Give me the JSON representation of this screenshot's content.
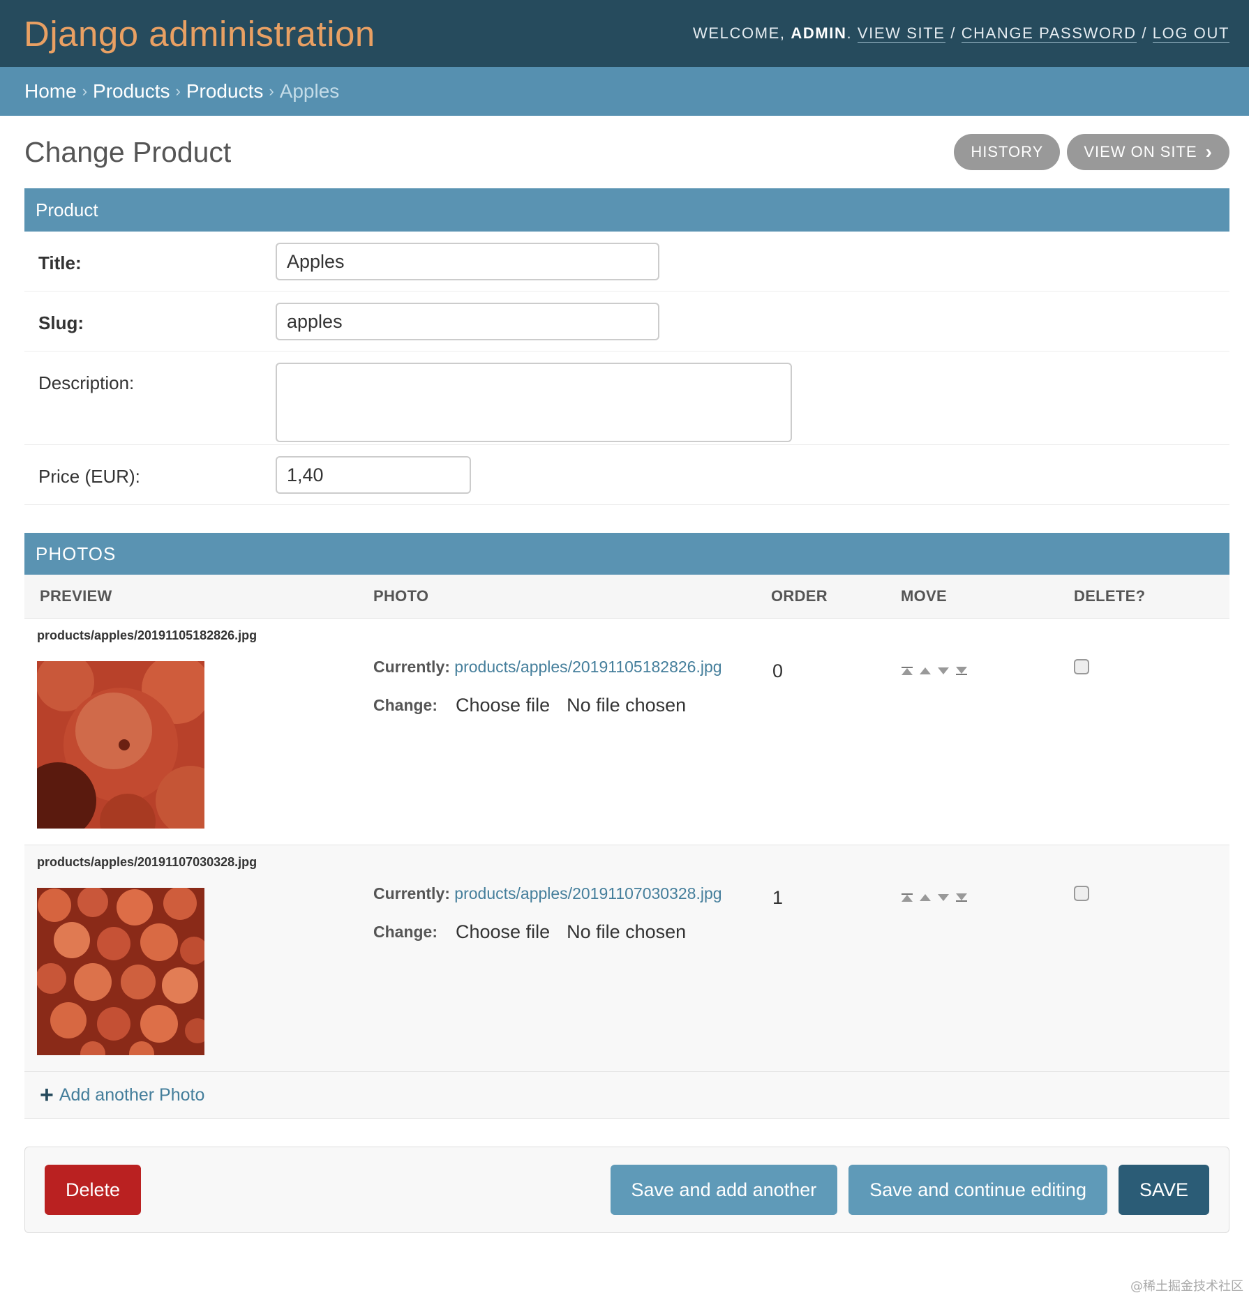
{
  "header": {
    "branding": "Django administration",
    "welcome_prefix": "WELCOME, ",
    "username": "ADMIN",
    "welcome_suffix": ". ",
    "view_site": "VIEW SITE",
    "sep1": " / ",
    "change_password": "CHANGE PASSWORD",
    "sep2": " / ",
    "log_out": "LOG OUT"
  },
  "breadcrumbs": {
    "home": "Home",
    "app": "Products",
    "model": "Products",
    "current": "Apples",
    "separator": "›"
  },
  "page": {
    "title": "Change Product",
    "history": "HISTORY",
    "view_on_site": "VIEW ON SITE",
    "view_on_site_chevron": "›"
  },
  "product_fieldset": {
    "title": "Product",
    "fields": {
      "title_label": "Title:",
      "title_value": "Apples",
      "slug_label": "Slug:",
      "slug_value": "apples",
      "description_label": "Description:",
      "description_value": "",
      "price_label": "Price (EUR):",
      "price_value": "1,40"
    }
  },
  "photos_inline": {
    "title": "PHOTOS",
    "columns": {
      "preview": "PREVIEW",
      "photo": "PHOTO",
      "order": "ORDER",
      "move": "MOVE",
      "delete": "DELETE?"
    },
    "rows": [
      {
        "filename": "products/apples/20191105182826.jpg",
        "currently_label": "Currently:",
        "currently_link": "products/apples/20191105182826.jpg",
        "change_label": "Change:",
        "choose_file": "Choose file",
        "no_file": "No file chosen",
        "order": "0"
      },
      {
        "filename": "products/apples/20191107030328.jpg",
        "currently_label": "Currently:",
        "currently_link": "products/apples/20191107030328.jpg",
        "change_label": "Change:",
        "choose_file": "Choose file",
        "no_file": "No file chosen",
        "order": "1"
      }
    ],
    "add_another": "Add another Photo"
  },
  "submit_row": {
    "delete": "Delete",
    "save_add_another": "Save and add another",
    "save_continue": "Save and continue editing",
    "save": "SAVE"
  },
  "watermark": "@稀土掘金技术社区",
  "colors": {
    "header_bg": "#264b5d",
    "branding": "#e9a063",
    "breadcrumbs_bg": "#5690b0",
    "module_head_bg": "#5a93b2",
    "delete_btn": "#ba2121",
    "save_btn": "#2b5c76",
    "secondary_btn": "#5f9ab8",
    "link": "#447e9b"
  }
}
